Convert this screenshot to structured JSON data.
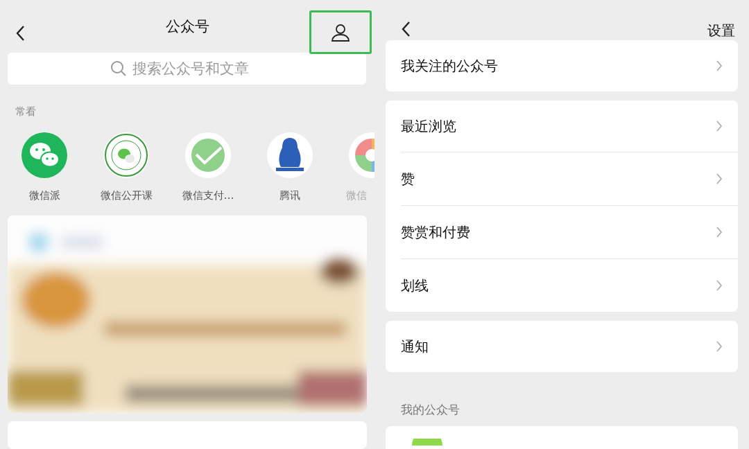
{
  "left": {
    "header": {
      "title": "公众号",
      "profile_highlighted": true
    },
    "search": {
      "placeholder": "搜索公众号和文章"
    },
    "frequent": {
      "heading": "常看",
      "accounts": [
        {
          "name": "微信派",
          "kind": "wechat"
        },
        {
          "name": "微信公开课",
          "kind": "openclass"
        },
        {
          "name": "微信支付…",
          "kind": "pay"
        },
        {
          "name": "腾讯",
          "kind": "tencent"
        },
        {
          "name": "微信",
          "kind": "palette"
        }
      ]
    }
  },
  "right": {
    "header": {
      "action": "设置"
    },
    "groups": [
      [
        {
          "label": "我关注的公众号"
        }
      ],
      [
        {
          "label": "最近浏览"
        },
        {
          "label": "赞"
        },
        {
          "label": "赞赏和付费"
        },
        {
          "label": "划线"
        }
      ],
      [
        {
          "label": "通知"
        }
      ]
    ],
    "section": "我的公众号"
  }
}
